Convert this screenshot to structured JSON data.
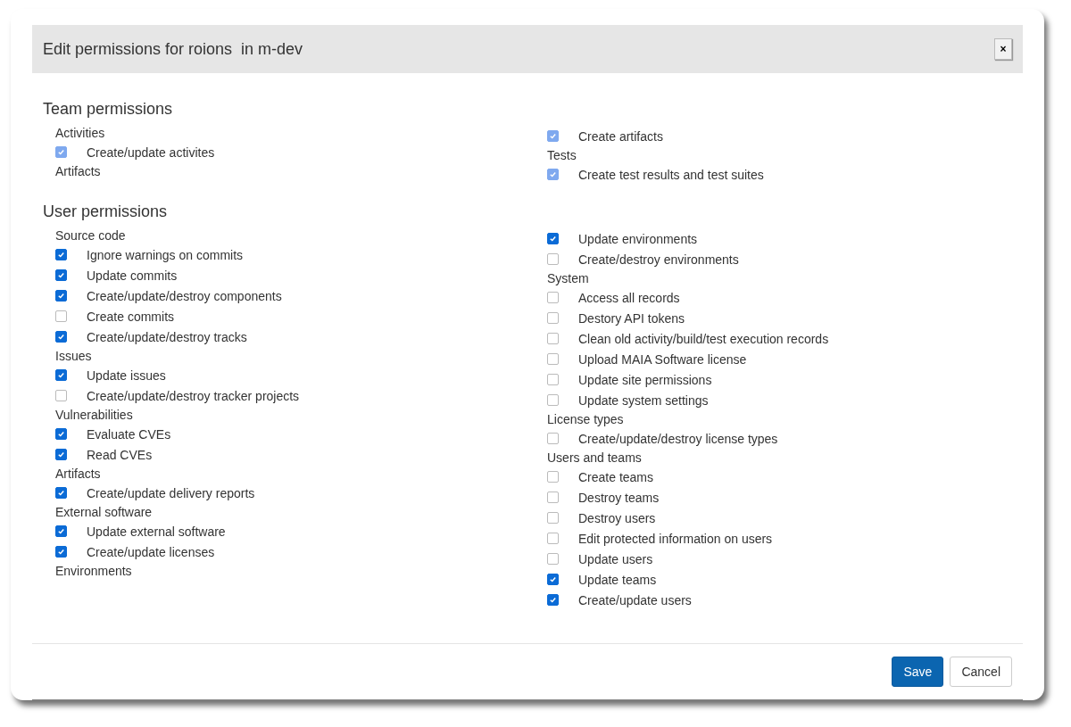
{
  "dialog": {
    "title": "Edit permissions for roions  in m-dev",
    "close_label": "×"
  },
  "sections": [
    {
      "title": "Team permissions",
      "columns": [
        [
          {
            "kind": "group",
            "label": "Activities"
          },
          {
            "kind": "permission",
            "label": "Create/update activites",
            "checked": true,
            "disabled": true
          },
          {
            "kind": "group",
            "label": "Artifacts"
          }
        ],
        [
          {
            "kind": "permission",
            "label": "Create artifacts",
            "checked": true,
            "disabled": true
          },
          {
            "kind": "group",
            "label": "Tests"
          },
          {
            "kind": "permission",
            "label": "Create test results and test suites",
            "checked": true,
            "disabled": true
          }
        ]
      ]
    },
    {
      "title": "User permissions",
      "columns": [
        [
          {
            "kind": "group",
            "label": "Source code"
          },
          {
            "kind": "permission",
            "label": "Ignore warnings on commits",
            "checked": true,
            "disabled": false
          },
          {
            "kind": "permission",
            "label": "Update commits",
            "checked": true,
            "disabled": false
          },
          {
            "kind": "permission",
            "label": "Create/update/destroy components",
            "checked": true,
            "disabled": false
          },
          {
            "kind": "permission",
            "label": "Create commits",
            "checked": false,
            "disabled": false
          },
          {
            "kind": "permission",
            "label": "Create/update/destroy tracks",
            "checked": true,
            "disabled": false
          },
          {
            "kind": "group",
            "label": "Issues"
          },
          {
            "kind": "permission",
            "label": "Update issues",
            "checked": true,
            "disabled": false
          },
          {
            "kind": "permission",
            "label": "Create/update/destroy tracker projects",
            "checked": false,
            "disabled": false
          },
          {
            "kind": "group",
            "label": "Vulnerabilities"
          },
          {
            "kind": "permission",
            "label": "Evaluate CVEs",
            "checked": true,
            "disabled": false
          },
          {
            "kind": "permission",
            "label": "Read CVEs",
            "checked": true,
            "disabled": false
          },
          {
            "kind": "group",
            "label": "Artifacts"
          },
          {
            "kind": "permission",
            "label": "Create/update delivery reports",
            "checked": true,
            "disabled": false
          },
          {
            "kind": "group",
            "label": "External software"
          },
          {
            "kind": "permission",
            "label": "Update external software",
            "checked": true,
            "disabled": false
          },
          {
            "kind": "permission",
            "label": "Create/update licenses",
            "checked": true,
            "disabled": false
          },
          {
            "kind": "group",
            "label": "Environments"
          }
        ],
        [
          {
            "kind": "permission",
            "label": "Update environments",
            "checked": true,
            "disabled": false
          },
          {
            "kind": "permission",
            "label": "Create/destroy environments",
            "checked": false,
            "disabled": false
          },
          {
            "kind": "group",
            "label": "System"
          },
          {
            "kind": "permission",
            "label": "Access all records",
            "checked": false,
            "disabled": false
          },
          {
            "kind": "permission",
            "label": "Destory API tokens",
            "checked": false,
            "disabled": false
          },
          {
            "kind": "permission",
            "label": "Clean old activity/build/test execution records",
            "checked": false,
            "disabled": false
          },
          {
            "kind": "permission",
            "label": "Upload MAIA Software license",
            "checked": false,
            "disabled": false
          },
          {
            "kind": "permission",
            "label": "Update site permissions",
            "checked": false,
            "disabled": false
          },
          {
            "kind": "permission",
            "label": "Update system settings",
            "checked": false,
            "disabled": false
          },
          {
            "kind": "group",
            "label": "License types"
          },
          {
            "kind": "permission",
            "label": "Create/update/destroy license types",
            "checked": false,
            "disabled": false
          },
          {
            "kind": "group",
            "label": "Users and teams"
          },
          {
            "kind": "permission",
            "label": "Create teams",
            "checked": false,
            "disabled": false
          },
          {
            "kind": "permission",
            "label": "Destroy teams",
            "checked": false,
            "disabled": false
          },
          {
            "kind": "permission",
            "label": "Destroy users",
            "checked": false,
            "disabled": false
          },
          {
            "kind": "permission",
            "label": "Edit protected information on users",
            "checked": false,
            "disabled": false
          },
          {
            "kind": "permission",
            "label": "Update users",
            "checked": false,
            "disabled": false
          },
          {
            "kind": "permission",
            "label": "Update teams",
            "checked": true,
            "disabled": false
          },
          {
            "kind": "permission",
            "label": "Create/update users",
            "checked": true,
            "disabled": false
          }
        ]
      ]
    }
  ],
  "buttons": [
    {
      "label": "Save",
      "kind": "primary"
    },
    {
      "label": "Cancel",
      "kind": "default"
    }
  ]
}
